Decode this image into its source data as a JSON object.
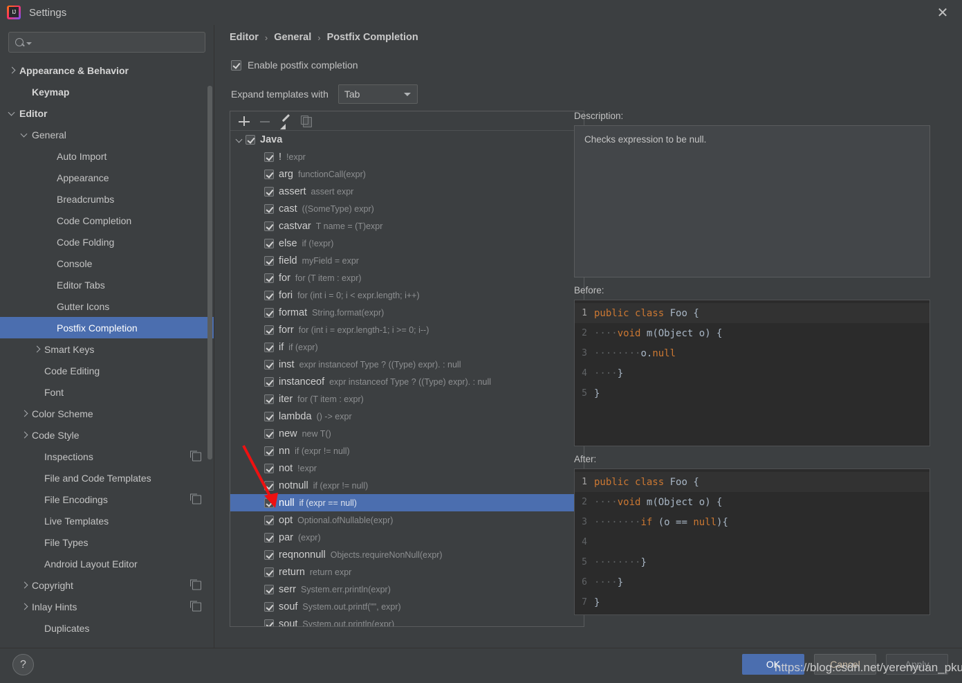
{
  "window": {
    "title": "Settings",
    "logo_text": "IJ",
    "close_label": "✕"
  },
  "sidebar": {
    "search": {
      "placeholder": "",
      "value": "",
      "icon": "search-icon"
    },
    "items": [
      {
        "label": "Appearance & Behavior",
        "indent": 0,
        "chevron": "right",
        "bold": true,
        "selected": false,
        "config_icon": false
      },
      {
        "label": "Keymap",
        "indent": 1,
        "chevron": "none",
        "bold": true,
        "selected": false,
        "config_icon": false
      },
      {
        "label": "Editor",
        "indent": 0,
        "chevron": "down",
        "bold": true,
        "selected": false,
        "config_icon": false
      },
      {
        "label": "General",
        "indent": 1,
        "chevron": "down",
        "bold": false,
        "selected": false,
        "config_icon": false
      },
      {
        "label": "Auto Import",
        "indent": 3,
        "chevron": "none",
        "bold": false,
        "selected": false,
        "config_icon": false
      },
      {
        "label": "Appearance",
        "indent": 3,
        "chevron": "none",
        "bold": false,
        "selected": false,
        "config_icon": false
      },
      {
        "label": "Breadcrumbs",
        "indent": 3,
        "chevron": "none",
        "bold": false,
        "selected": false,
        "config_icon": false
      },
      {
        "label": "Code Completion",
        "indent": 3,
        "chevron": "none",
        "bold": false,
        "selected": false,
        "config_icon": false
      },
      {
        "label": "Code Folding",
        "indent": 3,
        "chevron": "none",
        "bold": false,
        "selected": false,
        "config_icon": false
      },
      {
        "label": "Console",
        "indent": 3,
        "chevron": "none",
        "bold": false,
        "selected": false,
        "config_icon": false
      },
      {
        "label": "Editor Tabs",
        "indent": 3,
        "chevron": "none",
        "bold": false,
        "selected": false,
        "config_icon": false
      },
      {
        "label": "Gutter Icons",
        "indent": 3,
        "chevron": "none",
        "bold": false,
        "selected": false,
        "config_icon": false
      },
      {
        "label": "Postfix Completion",
        "indent": 3,
        "chevron": "none",
        "bold": false,
        "selected": true,
        "config_icon": false
      },
      {
        "label": "Smart Keys",
        "indent": 2,
        "chevron": "right",
        "bold": false,
        "selected": false,
        "config_icon": false
      },
      {
        "label": "Code Editing",
        "indent": 2,
        "chevron": "none",
        "bold": false,
        "selected": false,
        "config_icon": false
      },
      {
        "label": "Font",
        "indent": 2,
        "chevron": "none",
        "bold": false,
        "selected": false,
        "config_icon": false
      },
      {
        "label": "Color Scheme",
        "indent": 1,
        "chevron": "right",
        "bold": false,
        "selected": false,
        "config_icon": false
      },
      {
        "label": "Code Style",
        "indent": 1,
        "chevron": "right",
        "bold": false,
        "selected": false,
        "config_icon": false
      },
      {
        "label": "Inspections",
        "indent": 2,
        "chevron": "none",
        "bold": false,
        "selected": false,
        "config_icon": true
      },
      {
        "label": "File and Code Templates",
        "indent": 2,
        "chevron": "none",
        "bold": false,
        "selected": false,
        "config_icon": false
      },
      {
        "label": "File Encodings",
        "indent": 2,
        "chevron": "none",
        "bold": false,
        "selected": false,
        "config_icon": true
      },
      {
        "label": "Live Templates",
        "indent": 2,
        "chevron": "none",
        "bold": false,
        "selected": false,
        "config_icon": false
      },
      {
        "label": "File Types",
        "indent": 2,
        "chevron": "none",
        "bold": false,
        "selected": false,
        "config_icon": false
      },
      {
        "label": "Android Layout Editor",
        "indent": 2,
        "chevron": "none",
        "bold": false,
        "selected": false,
        "config_icon": false
      },
      {
        "label": "Copyright",
        "indent": 1,
        "chevron": "right",
        "bold": false,
        "selected": false,
        "config_icon": true
      },
      {
        "label": "Inlay Hints",
        "indent": 1,
        "chevron": "right",
        "bold": false,
        "selected": false,
        "config_icon": true
      },
      {
        "label": "Duplicates",
        "indent": 2,
        "chevron": "none",
        "bold": false,
        "selected": false,
        "config_icon": false
      }
    ]
  },
  "main": {
    "breadcrumb": [
      "Editor",
      "General",
      "Postfix Completion"
    ],
    "breadcrumb_separator": "›",
    "enable_checkbox": {
      "label": "Enable postfix completion",
      "checked": true
    },
    "expand_row": {
      "label": "Expand templates with",
      "value": "Tab"
    },
    "toolbar": {
      "add_title": "+",
      "remove_title": "−",
      "edit_title": "edit",
      "copy_title": "copy"
    },
    "templates": [
      {
        "key": "Java",
        "desc": "",
        "checked": true,
        "root": true
      },
      {
        "key": "!",
        "desc": "!expr",
        "checked": true,
        "root": false
      },
      {
        "key": "arg",
        "desc": "functionCall(expr)",
        "checked": true,
        "root": false
      },
      {
        "key": "assert",
        "desc": "assert expr",
        "checked": true,
        "root": false
      },
      {
        "key": "cast",
        "desc": "((SomeType) expr)",
        "checked": true,
        "root": false
      },
      {
        "key": "castvar",
        "desc": "T name = (T)expr",
        "checked": true,
        "root": false
      },
      {
        "key": "else",
        "desc": "if (!expr)",
        "checked": true,
        "root": false
      },
      {
        "key": "field",
        "desc": "myField = expr",
        "checked": true,
        "root": false
      },
      {
        "key": "for",
        "desc": "for (T item : expr)",
        "checked": true,
        "root": false
      },
      {
        "key": "fori",
        "desc": "for (int i = 0; i < expr.length; i++)",
        "checked": true,
        "root": false
      },
      {
        "key": "format",
        "desc": "String.format(expr)",
        "checked": true,
        "root": false
      },
      {
        "key": "forr",
        "desc": "for (int i = expr.length-1; i >= 0; i--)",
        "checked": true,
        "root": false
      },
      {
        "key": "if",
        "desc": "if (expr)",
        "checked": true,
        "root": false
      },
      {
        "key": "inst",
        "desc": "expr instanceof Type ? ((Type) expr). : null",
        "checked": true,
        "root": false
      },
      {
        "key": "instanceof",
        "desc": "expr instanceof Type ? ((Type) expr). : null",
        "checked": true,
        "root": false
      },
      {
        "key": "iter",
        "desc": "for (T item : expr)",
        "checked": true,
        "root": false
      },
      {
        "key": "lambda",
        "desc": "() -> expr",
        "checked": true,
        "root": false
      },
      {
        "key": "new",
        "desc": "new T()",
        "checked": true,
        "root": false
      },
      {
        "key": "nn",
        "desc": "if (expr != null)",
        "checked": true,
        "root": false
      },
      {
        "key": "not",
        "desc": "!expr",
        "checked": true,
        "root": false
      },
      {
        "key": "notnull",
        "desc": "if (expr != null)",
        "checked": true,
        "root": false
      },
      {
        "key": "null",
        "desc": "if (expr == null)",
        "checked": true,
        "root": false,
        "selected": true
      },
      {
        "key": "opt",
        "desc": "Optional.ofNullable(expr)",
        "checked": true,
        "root": false
      },
      {
        "key": "par",
        "desc": "(expr)",
        "checked": true,
        "root": false
      },
      {
        "key": "reqnonnull",
        "desc": "Objects.requireNonNull(expr)",
        "checked": true,
        "root": false
      },
      {
        "key": "return",
        "desc": "return expr",
        "checked": true,
        "root": false
      },
      {
        "key": "serr",
        "desc": "System.err.println(expr)",
        "checked": true,
        "root": false
      },
      {
        "key": "souf",
        "desc": "System.out.printf(\"\", expr)",
        "checked": true,
        "root": false
      },
      {
        "key": "sout",
        "desc": "System.out.println(expr)",
        "checked": true,
        "root": false
      }
    ],
    "description": {
      "label": "Description:",
      "text": "Checks expression to be null."
    },
    "before": {
      "label": "Before:",
      "lines": [
        {
          "n": "1",
          "code": "public class Foo {"
        },
        {
          "n": "2",
          "code": "    void m(Object o) {"
        },
        {
          "n": "3",
          "code": "        o.null"
        },
        {
          "n": "4",
          "code": "    }"
        },
        {
          "n": "5",
          "code": "}"
        }
      ]
    },
    "after": {
      "label": "After:",
      "lines": [
        {
          "n": "1",
          "code": "public class Foo {"
        },
        {
          "n": "2",
          "code": "    void m(Object o) {"
        },
        {
          "n": "3",
          "code": "        if (o == null){"
        },
        {
          "n": "4",
          "code": ""
        },
        {
          "n": "5",
          "code": "        }"
        },
        {
          "n": "6",
          "code": "    }"
        },
        {
          "n": "7",
          "code": "}"
        }
      ]
    }
  },
  "footer": {
    "help_label": "?",
    "ok_label": "OK",
    "cancel_label": "Cancel",
    "apply_label": "Apply"
  },
  "watermark": "https://blog.csdn.net/yerenyuan_pku",
  "colors": {
    "selection_blue": "#4b6eaf",
    "background": "#3c3f41",
    "code_background": "#2b2b2b",
    "keyword_orange": "#cc7832",
    "plain_text": "#a9b7c6",
    "arrow_red": "#ee1111"
  }
}
